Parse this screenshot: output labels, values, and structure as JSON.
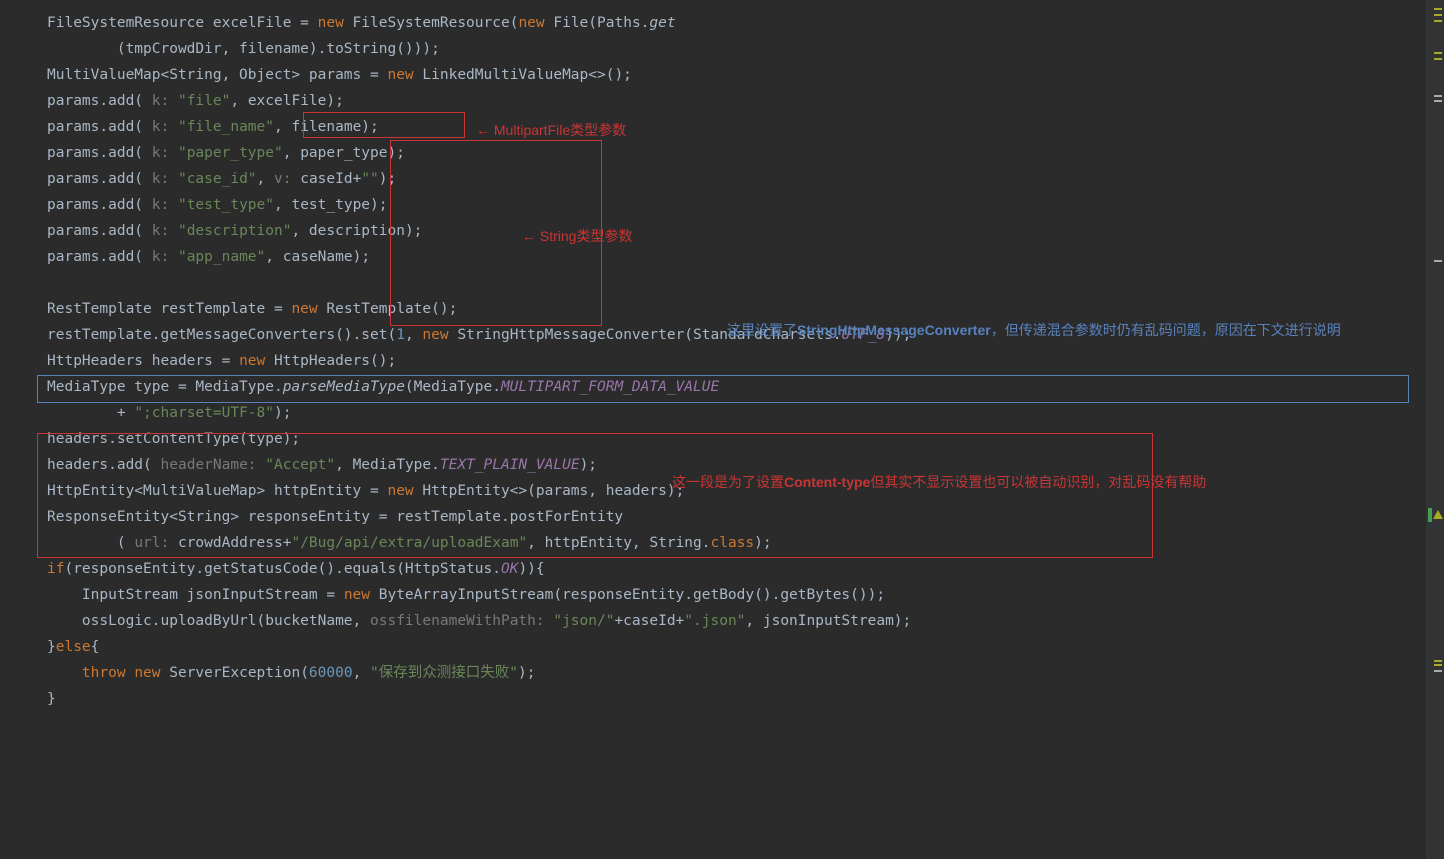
{
  "code": {
    "l1_a": "FileSystemResource excelFile = ",
    "l1_new": "new",
    "l1_b": " FileSystemResource(",
    "l1_new2": "new",
    "l1_c": " File(Paths.",
    "l1_get": "get",
    "l2": "        (tmpCrowdDir, filename).toString()));",
    "l3_a": "MultiValueMap<String, Object> params = ",
    "l3_new": "new",
    "l3_b": " LinkedMultiValueMap<>();",
    "l4_a": "params.add( ",
    "l4_k": "k: ",
    "l4_s": "\"file\"",
    "l4_b": ", ",
    "l4_c": "excelFile);",
    "l5_a": "params.add( ",
    "l5_k": "k: ",
    "l5_s": "\"file_name\"",
    "l5_b": ", ",
    "l5_c": "filename);",
    "l6_a": "params.add( ",
    "l6_k": "k: ",
    "l6_s": "\"paper_type\"",
    "l6_b": ", paper_type);",
    "l7_a": "params.add( ",
    "l7_k": "k: ",
    "l7_s": "\"case_id\"",
    "l7_b": ", ",
    "l7_v": "v: ",
    "l7_c": "caseId+",
    "l7_s2": "\"\"",
    "l7_d": ");",
    "l8_a": "params.add( ",
    "l8_k": "k: ",
    "l8_s": "\"test_type\"",
    "l8_b": ", test_type);",
    "l9_a": "params.add( ",
    "l9_k": "k: ",
    "l9_s": "\"description\"",
    "l9_b": ", description);",
    "l10_a": "params.add( ",
    "l10_k": "k: ",
    "l10_s": "\"app_name\"",
    "l10_b": ", ",
    "l10_c": "caseName);",
    "l12_a": "RestTemplate restTemplate = ",
    "l12_new": "new",
    "l12_b": " RestTemplate();",
    "l13_a": "restTemplate.getMessageConverters().set(",
    "l13_n": "1",
    "l13_b": ", ",
    "l13_new": "new",
    "l13_c": " StringHttpMessageConverter(StandardCharsets.",
    "l13_utf": "UTF_8",
    "l13_d": "));",
    "l14_a": "HttpHeaders headers = ",
    "l14_new": "new",
    "l14_b": " HttpHeaders();",
    "l15_a": "MediaType type = MediaType.",
    "l15_m": "parseMediaType",
    "l15_b": "(MediaType.",
    "l15_c": "MULTIPART_FORM_DATA_VALUE",
    "l16_a": "        + ",
    "l16_s": "\";charset=UTF-8\"",
    "l16_b": ");",
    "l17": "headers.setContentType(type);",
    "l18_a": "headers.add( ",
    "l18_h": "headerName: ",
    "l18_s": "\"Accept\"",
    "l18_b": ", MediaType.",
    "l18_c": "TEXT_PLAIN_VALUE",
    "l18_d": ");",
    "l19_a": "HttpEntity<MultiValueMap> httpEntity = ",
    "l19_new": "new",
    "l19_b": " HttpEntity<>(params, headers);",
    "l20_a": "ResponseEntity<String> responseEntity = restTemplate.postForEntity",
    "l21_a": "        ( ",
    "l21_h": "url: ",
    "l21_b": "crowdAddress+",
    "l21_s": "\"/Bug/api/extra/uploadExam\"",
    "l21_c": ", httpEntity, String.",
    "l21_cl": "class",
    "l21_d": ");",
    "l22_a": "if",
    "l22_b": "(responseEntity.getStatusCode().equals(HttpStatus.",
    "l22_ok": "OK",
    "l22_c": ")){",
    "l23_a": "    InputStream jsonInputStream = ",
    "l23_new": "new",
    "l23_b": " ByteArrayInputStream(responseEntity.getBody().getBytes());",
    "l24_a": "    ossLogic.uploadByUrl(bucketName, ",
    "l24_h": "ossfilenameWithPath: ",
    "l24_s": "\"json/\"",
    "l24_b": "+caseId+",
    "l24_s2": "\".json\"",
    "l24_c": ", jsonInputStream);",
    "l25_a": "}",
    "l25_else": "else",
    "l25_b": "{",
    "l26_a": "    ",
    "l26_throw": "throw",
    "l26_sp": " ",
    "l26_new": "new",
    "l26_b": " ServerException(",
    "l26_n": "60000",
    "l26_c": ", ",
    "l26_s": "\"保存到众测接口失败\"",
    "l26_d": ");",
    "l27": "}"
  },
  "annotations": {
    "multipart": "MultipartFile类型参数",
    "string_param": "String类型参数",
    "converter1": "这里设置了",
    "converter1b": "StringHttpMessageConverter",
    "converter1c": "，但传递混合参数时仍有乱码问题，原因在下文进行说明",
    "contenttype1": "这一段是为了设置",
    "contenttype1b": "Content-type",
    "contenttype1c": "但其实不显示设置也可以被自动识别，对乱码没有帮助"
  },
  "arrows": {
    "left": "←"
  }
}
